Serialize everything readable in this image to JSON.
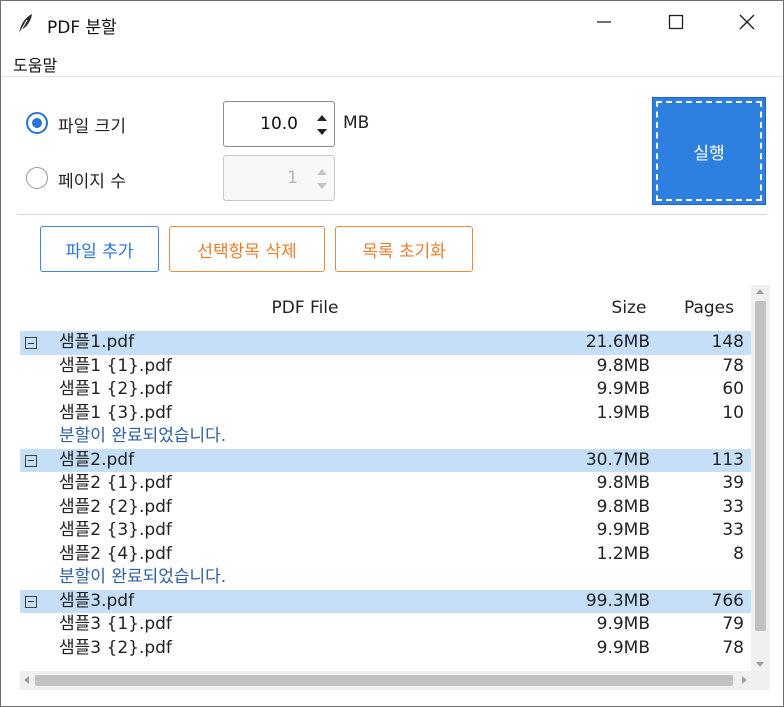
{
  "window": {
    "title": "PDF 분할",
    "menu": [
      "도움말"
    ]
  },
  "options": {
    "file_size_label": "파일 크기",
    "file_size_selected": true,
    "file_size_value": "10.0",
    "file_size_unit": "MB",
    "pages_label": "페이지 수",
    "pages_selected": false,
    "pages_value": "1",
    "run_label": "실행"
  },
  "actions": {
    "add_label": "파일 추가",
    "delete_label": "선택항목 삭제",
    "reset_label": "목록 초기화"
  },
  "colors": {
    "accent": "#2d7fe0",
    "danger_outline": "#ee7c2a",
    "group_row": "#c5dff8",
    "status_text": "#2f5fa0"
  },
  "icons": {
    "app": "feather-icon",
    "minimize": "minimize-icon",
    "maximize": "maximize-icon",
    "close": "close-icon",
    "collapse": "collapse-box-icon"
  },
  "tree": {
    "columns": [
      "PDF File",
      "Size",
      "Pages"
    ],
    "rows": [
      {
        "kind": "group",
        "name": "샘플1.pdf",
        "size": "21.6MB",
        "pages": "148"
      },
      {
        "kind": "child",
        "name": "샘플1 {1}.pdf",
        "size": "9.8MB",
        "pages": "78"
      },
      {
        "kind": "child",
        "name": "샘플1 {2}.pdf",
        "size": "9.9MB",
        "pages": "60"
      },
      {
        "kind": "child",
        "name": "샘플1 {3}.pdf",
        "size": "1.9MB",
        "pages": "10"
      },
      {
        "kind": "status",
        "name": "분할이 완료되었습니다.",
        "size": "",
        "pages": ""
      },
      {
        "kind": "group",
        "name": "샘플2.pdf",
        "size": "30.7MB",
        "pages": "113"
      },
      {
        "kind": "child",
        "name": "샘플2 {1}.pdf",
        "size": "9.8MB",
        "pages": "39"
      },
      {
        "kind": "child",
        "name": "샘플2 {2}.pdf",
        "size": "9.8MB",
        "pages": "33"
      },
      {
        "kind": "child",
        "name": "샘플2 {3}.pdf",
        "size": "9.9MB",
        "pages": "33"
      },
      {
        "kind": "child",
        "name": "샘플2 {4}.pdf",
        "size": "1.2MB",
        "pages": "8"
      },
      {
        "kind": "status",
        "name": "분할이 완료되었습니다.",
        "size": "",
        "pages": ""
      },
      {
        "kind": "group",
        "name": "샘플3.pdf",
        "size": "99.3MB",
        "pages": "766"
      },
      {
        "kind": "child",
        "name": "샘플3 {1}.pdf",
        "size": "9.9MB",
        "pages": "79"
      },
      {
        "kind": "child",
        "name": "샘플3 {2}.pdf",
        "size": "9.9MB",
        "pages": "78"
      }
    ]
  }
}
